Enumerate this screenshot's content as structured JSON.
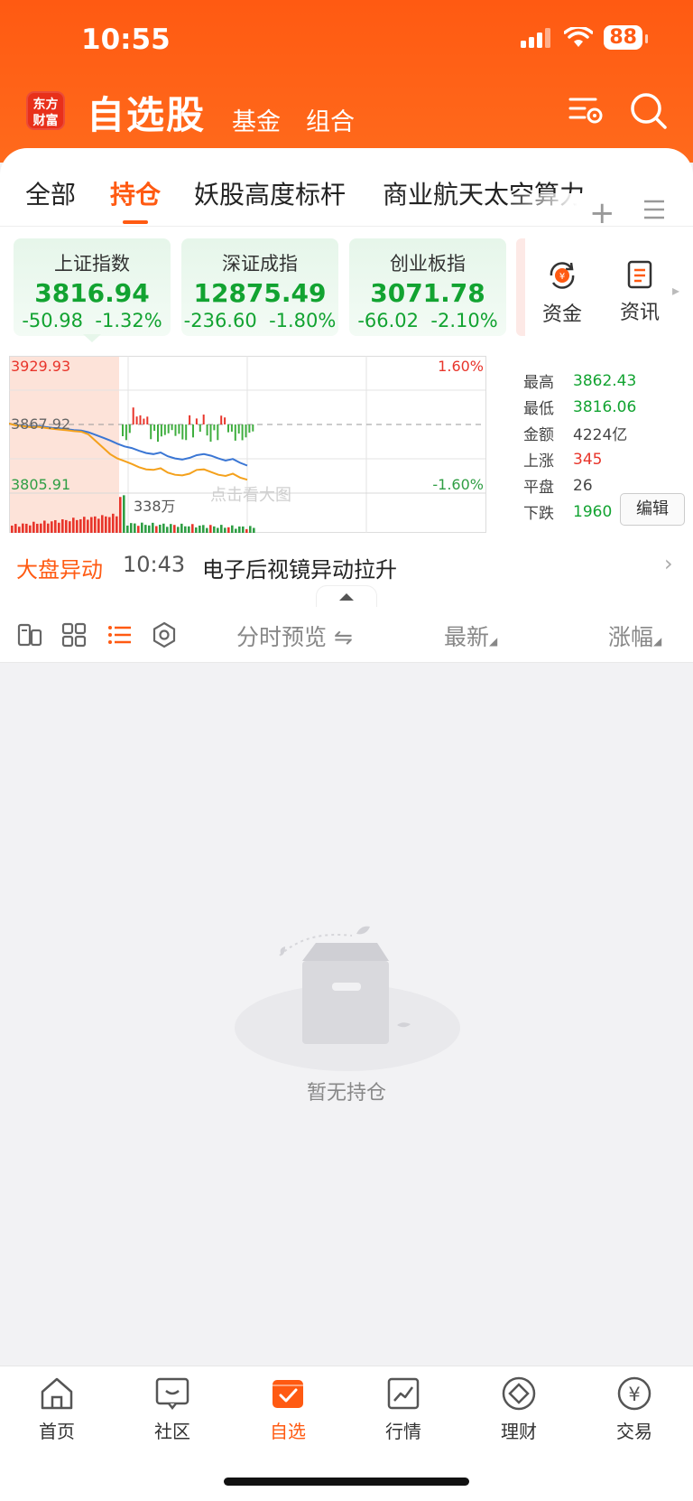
{
  "status_bar": {
    "time": "10:55",
    "battery": "88"
  },
  "header": {
    "logo_line1": "东方",
    "logo_line2": "财富",
    "title": "自选股",
    "sub_tabs": [
      "基金",
      "组合"
    ]
  },
  "tabs": [
    "全部",
    "持仓",
    "妖股高度标杆",
    "商业航天太空算力"
  ],
  "active_tab": "持仓",
  "indices": [
    {
      "name": "上证指数",
      "value": "3816.94",
      "change": "-50.98",
      "pct": "-1.32%"
    },
    {
      "name": "深证成指",
      "value": "12875.49",
      "change": "-236.60",
      "pct": "-1.80%"
    },
    {
      "name": "创业板指",
      "value": "3071.78",
      "change": "-66.02",
      "pct": "-2.10%"
    }
  ],
  "quick_links": [
    {
      "label": "资金",
      "icon": "yuan-cycle-icon"
    },
    {
      "label": "资讯",
      "icon": "document-icon"
    }
  ],
  "chart_data": {
    "type": "line",
    "y_top": "3929.93",
    "y_mid": "3867.92",
    "y_bottom": "3805.91",
    "pct_top": "1.60%",
    "pct_bottom": "-1.60%",
    "volume_label": "338万",
    "overlay_text": "点击看大图",
    "ylim": [
      3805.91,
      3929.93
    ],
    "series": [
      {
        "values": [
          3867.9,
          3866.5,
          3866.0,
          3865.2,
          3865.8,
          3864.9,
          3864.0,
          3863.5,
          3862.8,
          3862.0,
          3861.5,
          3860.0,
          3857.5,
          3855.0,
          3852.5,
          3849.5,
          3847.0,
          3845.5,
          3843.0,
          3841.0,
          3840.0,
          3841.5,
          3838.0,
          3836.0,
          3835.0,
          3836.5,
          3839.0,
          3840.0,
          3838.5,
          3836.0,
          3834.0,
          3835.5,
          3832.0,
          3829.5
        ]
      },
      {
        "values": [
          3867.9,
          3866.2,
          3865.5,
          3864.6,
          3865.0,
          3864.0,
          3863.2,
          3862.5,
          3861.8,
          3861.0,
          3860.5,
          3858.0,
          3852.0,
          3846.0,
          3840.0,
          3836.0,
          3833.5,
          3831.0,
          3828.0,
          3826.0,
          3825.5,
          3827.0,
          3823.0,
          3821.0,
          3820.5,
          3822.0,
          3825.5,
          3826.0,
          3823.5,
          3821.0,
          3820.0,
          3822.0,
          3818.5,
          3816.5
        ]
      }
    ],
    "xlim": [
      0,
      240
    ]
  },
  "stats": [
    {
      "label": "最高",
      "value": "3862.43",
      "color": "#12a331"
    },
    {
      "label": "最低",
      "value": "3816.06",
      "color": "#12a331"
    },
    {
      "label": "金额",
      "value": "4224亿",
      "color": "#444444"
    },
    {
      "label": "上涨",
      "value": "345",
      "color": "#e8352b"
    },
    {
      "label": "平盘",
      "value": "26",
      "color": "#444444"
    },
    {
      "label": "下跌",
      "value": "1960",
      "color": "#12a331"
    }
  ],
  "edit_label": "编辑",
  "alert": {
    "tag": "大盘异动",
    "time": "10:43",
    "text": "电子后视镜异动拉升"
  },
  "list_header": {
    "preview": "分时预览 ⇋",
    "latest": "最新",
    "change": "涨幅"
  },
  "empty_text": "暂无持仓",
  "bottom_nav": [
    {
      "label": "首页",
      "icon": "home-icon"
    },
    {
      "label": "社区",
      "icon": "chat-icon"
    },
    {
      "label": "自选",
      "icon": "checkbox-icon"
    },
    {
      "label": "行情",
      "icon": "trend-icon"
    },
    {
      "label": "理财",
      "icon": "diamond-icon"
    },
    {
      "label": "交易",
      "icon": "yuan-icon"
    }
  ],
  "colors": {
    "brand": "#ff5a12",
    "down": "#12a331",
    "up": "#e8352b"
  }
}
